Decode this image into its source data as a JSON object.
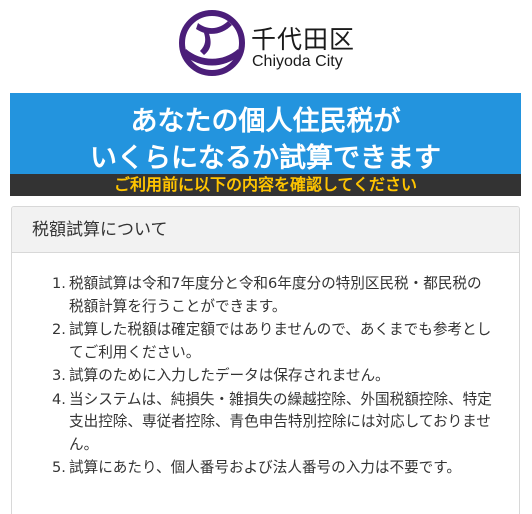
{
  "header": {
    "city_name": "千代田区",
    "city_name_roman": "Chiyoda City",
    "brand_color": "#4b1e79"
  },
  "banner": {
    "line1": "あなたの個人住民税が",
    "line2": "いくらになるか試算できます",
    "bg_color": "#2394de"
  },
  "notice": {
    "text": "ご利用前に以下の内容を確認してください",
    "text_color": "#ffc400"
  },
  "card": {
    "title": "税額試算について",
    "items": [
      {
        "num": "1.",
        "text": "税額試算は令和7年度分と令和6年度分の特別区民税・都民税の税額計算を行うことができます。"
      },
      {
        "num": "2.",
        "text": "試算した税額は確定額ではありませんので、あくまでも参考としてご利用ください。"
      },
      {
        "num": "3.",
        "text": "試算のために入力したデータは保存されません。"
      },
      {
        "num": "4.",
        "text": "当システムは、純損失・雑損失の繰越控除、外国税額控除、特定支出控除、専従者控除、青色申告特別控除には対応しておりません。"
      },
      {
        "num": "5.",
        "text": "試算にあたり、個人番号および法人番号の入力は不要です。"
      }
    ]
  }
}
